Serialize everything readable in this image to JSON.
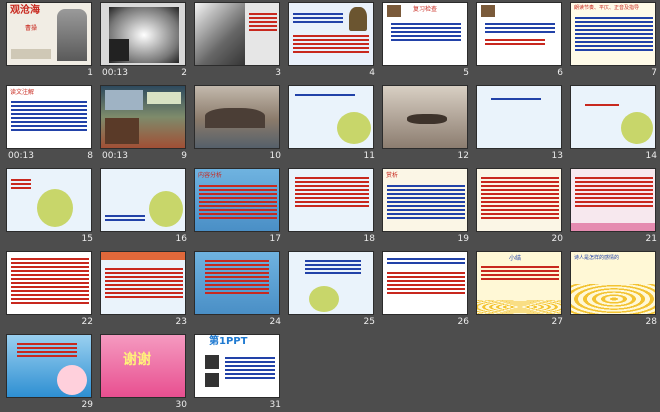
{
  "slides": [
    {
      "n": "1",
      "title": "观沧海",
      "sub": "曹操",
      "timing": ""
    },
    {
      "n": "2",
      "title": "",
      "sub": "",
      "timing": "00:13"
    },
    {
      "n": "3",
      "timing": ""
    },
    {
      "n": "4",
      "timing": ""
    },
    {
      "n": "5",
      "title": "复习检查",
      "timing": ""
    },
    {
      "n": "6",
      "timing": ""
    },
    {
      "n": "7",
      "title": "朗读节奏、平仄、正音及指导",
      "timing": ""
    },
    {
      "n": "8",
      "title": "读文注解",
      "timing": "00:13"
    },
    {
      "n": "9",
      "timing": "00:13"
    },
    {
      "n": "10",
      "timing": ""
    },
    {
      "n": "11",
      "timing": ""
    },
    {
      "n": "12",
      "timing": ""
    },
    {
      "n": "13",
      "timing": ""
    },
    {
      "n": "14",
      "timing": ""
    },
    {
      "n": "15",
      "timing": ""
    },
    {
      "n": "16",
      "timing": ""
    },
    {
      "n": "17",
      "title": "内容分析",
      "timing": ""
    },
    {
      "n": "18",
      "timing": ""
    },
    {
      "n": "19",
      "title": "赏析",
      "timing": ""
    },
    {
      "n": "20",
      "timing": ""
    },
    {
      "n": "21",
      "timing": ""
    },
    {
      "n": "22",
      "timing": ""
    },
    {
      "n": "23",
      "timing": ""
    },
    {
      "n": "24",
      "timing": ""
    },
    {
      "n": "25",
      "timing": ""
    },
    {
      "n": "26",
      "timing": ""
    },
    {
      "n": "27",
      "title": "小结",
      "timing": ""
    },
    {
      "n": "28",
      "title": "诗人是怎样的感情的",
      "timing": ""
    },
    {
      "n": "29",
      "timing": ""
    },
    {
      "n": "30",
      "title": "谢谢",
      "timing": ""
    },
    {
      "n": "31",
      "title": "第1PPT",
      "timing": ""
    }
  ],
  "colors": {
    "background": "#4d4d4d",
    "accent": "#c8281e",
    "blue": "#2242a8"
  }
}
